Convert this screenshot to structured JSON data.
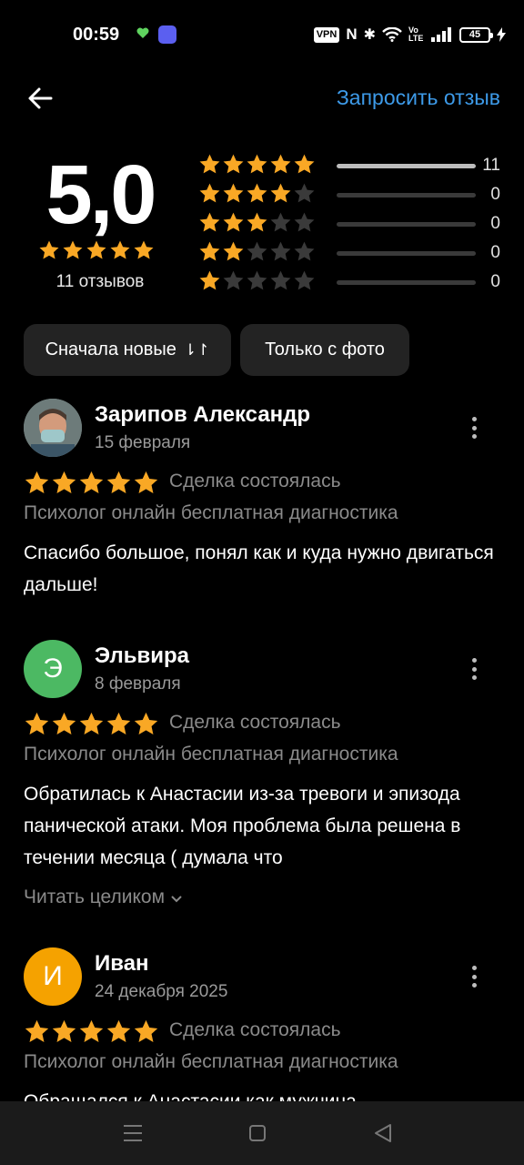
{
  "status_bar": {
    "time": "00:59",
    "vpn": "VPN",
    "nfc": "N",
    "lte": "Vo LTE",
    "battery": "45"
  },
  "header": {
    "back_icon": "arrow-left-icon",
    "request_review_label": "Запросить отзыв",
    "accent_color": "#3d9ae8"
  },
  "summary": {
    "average": "5,0",
    "average_stars": 5,
    "reviews_count_label": "11 отзывов",
    "distribution": [
      {
        "stars": 5,
        "count": "11",
        "fraction": 1.0
      },
      {
        "stars": 4,
        "count": "0",
        "fraction": 0
      },
      {
        "stars": 3,
        "count": "0",
        "fraction": 0
      },
      {
        "stars": 2,
        "count": "0",
        "fraction": 0
      },
      {
        "stars": 1,
        "count": "0",
        "fraction": 0
      }
    ],
    "star_color": "#f9a825"
  },
  "filters": {
    "sort_label": "Сначала новые",
    "photo_label": "Только с фото"
  },
  "reviews": [
    {
      "author": "Зарипов Александр",
      "date": "15 февраля",
      "avatar_letter": "",
      "rating": 5,
      "deal_status": "Сделка состоялась",
      "service": "Психолог онлайн бесплатная диагностика",
      "text": "Спасибо большое, понял как и куда нужно двигаться дальше!"
    },
    {
      "author": "Эльвира",
      "date": "8 февраля",
      "avatar_letter": "Э",
      "rating": 5,
      "deal_status": "Сделка состоялась",
      "service": "Психолог онлайн бесплатная диагностика",
      "text": "Обратилась к Анастасии из-за тревоги и эпизода панической атаки. Моя проблема была решена в течении месяца ( думала что",
      "read_more": "Читать целиком"
    },
    {
      "author": "Иван",
      "date": "24 декабря 2025",
      "avatar_letter": "И",
      "rating": 5,
      "deal_status": "Сделка состоялась",
      "service": "Психолог онлайн бесплатная диагностика",
      "text": "Обращался к Анастасии как мужчина"
    }
  ]
}
